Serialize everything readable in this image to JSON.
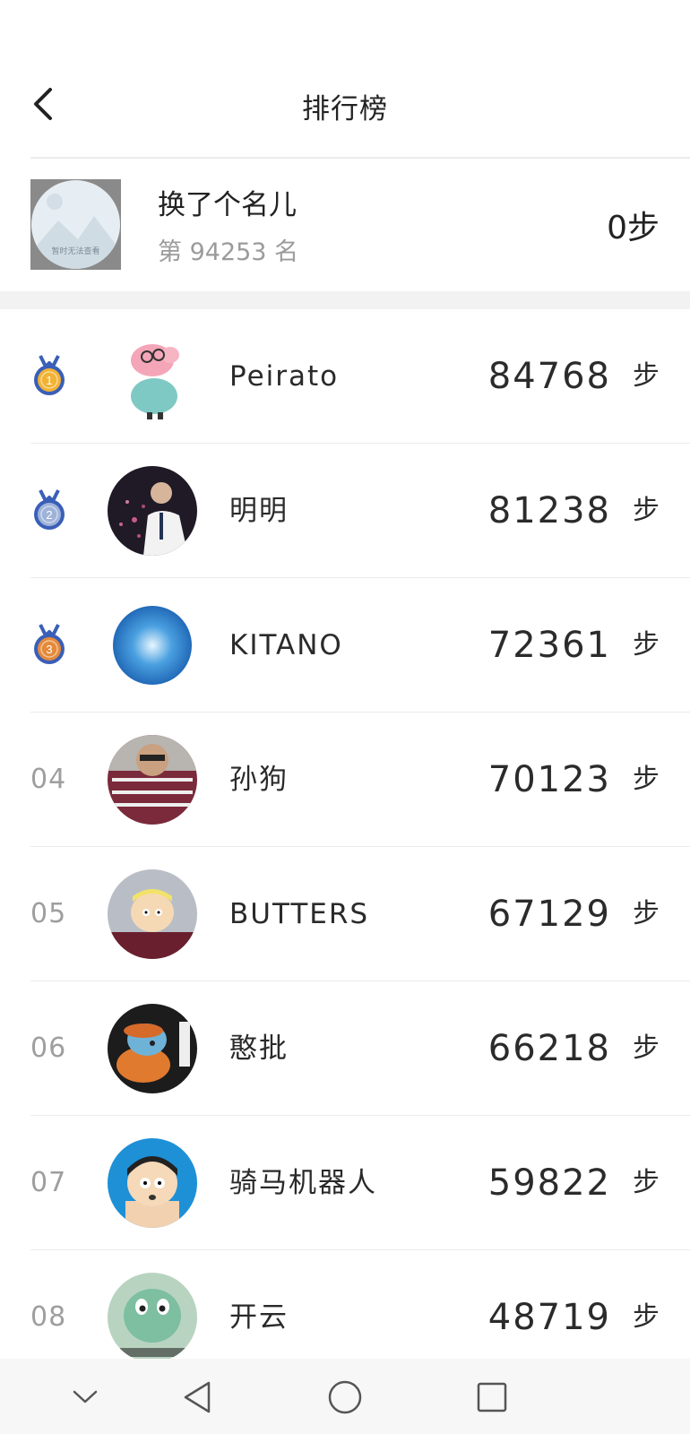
{
  "header": {
    "title": "排行榜",
    "back_icon": "chevron-left-icon"
  },
  "me": {
    "name": "换了个名儿",
    "rank_text": "第 94253 名",
    "steps": "0步",
    "avatar_placeholder": "暂时无法查看"
  },
  "unit": "步",
  "ranking": [
    {
      "rank": "01",
      "medal": "gold",
      "name": "Peirato",
      "steps": "84768",
      "avatar": "pig-avatar"
    },
    {
      "rank": "02",
      "medal": "silver",
      "name": "明明",
      "steps": "81238",
      "avatar": "photo-avatar"
    },
    {
      "rank": "03",
      "medal": "bronze",
      "name": "KITANO",
      "steps": "72361",
      "avatar": "blue-orb-avatar"
    },
    {
      "rank": "04",
      "medal": null,
      "name": "孙狗",
      "steps": "70123",
      "avatar": "meme-avatar"
    },
    {
      "rank": "05",
      "medal": null,
      "name": "BUTTERS",
      "steps": "67129",
      "avatar": "cartoon-avatar"
    },
    {
      "rank": "06",
      "medal": null,
      "name": "憨批",
      "steps": "66218",
      "avatar": "turtle-avatar"
    },
    {
      "rank": "07",
      "medal": null,
      "name": "骑马机器人",
      "steps": "59822",
      "avatar": "cartoon-boy-avatar"
    },
    {
      "rank": "08",
      "medal": null,
      "name": "开云",
      "steps": "48719",
      "avatar": "squirtle-avatar"
    }
  ],
  "medal_labels": {
    "gold": "1",
    "silver": "2",
    "bronze": "3"
  },
  "colors": {
    "gold": "#f2b233",
    "silver": "#9fb3d9",
    "bronze": "#e58a3a",
    "ribbon": "#3a5fb8"
  },
  "navbar": {
    "items": [
      "chevron-down-icon",
      "back-triangle-icon",
      "home-circle-icon",
      "recent-square-icon"
    ]
  }
}
